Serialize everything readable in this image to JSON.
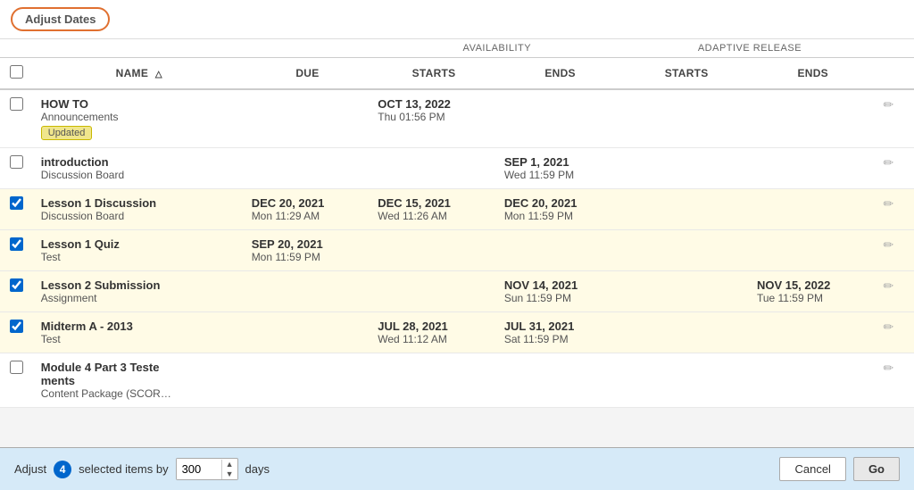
{
  "toolbar": {
    "adjust_dates_label": "Adjust Dates"
  },
  "table": {
    "section_headers": {
      "availability_label": "AVAILABILITY",
      "adaptive_release_label": "ADAPTIVE RELEASE"
    },
    "col_headers": {
      "name_label": "NAME",
      "due_label": "DUE",
      "avail_starts_label": "STARTS",
      "avail_ends_label": "ENDS",
      "ar_starts_label": "STARTS",
      "ar_ends_label": "ENDS"
    },
    "rows": [
      {
        "id": "row-how-to",
        "checked": false,
        "selected": false,
        "name": "HOW TO",
        "type": "Announcements",
        "badge": "Updated",
        "due": "",
        "due_sub": "",
        "avail_starts": "OCT 13, 2022",
        "avail_starts_sub": "Thu 01:56 PM",
        "avail_ends": "",
        "avail_ends_sub": "",
        "ar_starts": "",
        "ar_starts_sub": "",
        "ar_ends": "",
        "ar_ends_sub": ""
      },
      {
        "id": "row-introduction",
        "checked": false,
        "selected": false,
        "name": "introduction",
        "type": "Discussion Board",
        "badge": "",
        "due": "",
        "due_sub": "",
        "avail_starts": "",
        "avail_starts_sub": "",
        "avail_ends": "SEP 1, 2021",
        "avail_ends_sub": "Wed 11:59 PM",
        "ar_starts": "",
        "ar_starts_sub": "",
        "ar_ends": "",
        "ar_ends_sub": ""
      },
      {
        "id": "row-lesson1-discussion",
        "checked": true,
        "selected": true,
        "name": "Lesson 1 Discussion",
        "type": "Discussion Board",
        "badge": "",
        "due": "DEC 20, 2021",
        "due_sub": "Mon 11:29 AM",
        "avail_starts": "DEC 15, 2021",
        "avail_starts_sub": "Wed 11:26 AM",
        "avail_ends": "DEC 20, 2021",
        "avail_ends_sub": "Mon 11:59 PM",
        "ar_starts": "",
        "ar_starts_sub": "",
        "ar_ends": "",
        "ar_ends_sub": ""
      },
      {
        "id": "row-lesson1-quiz",
        "checked": true,
        "selected": true,
        "name": "Lesson 1 Quiz",
        "type": "Test",
        "badge": "",
        "due": "SEP 20, 2021",
        "due_sub": "Mon 11:59 PM",
        "avail_starts": "",
        "avail_starts_sub": "",
        "avail_ends": "",
        "avail_ends_sub": "",
        "ar_starts": "",
        "ar_starts_sub": "",
        "ar_ends": "",
        "ar_ends_sub": ""
      },
      {
        "id": "row-lesson2-submission",
        "checked": true,
        "selected": true,
        "name": "Lesson 2 Submission",
        "type": "Assignment",
        "badge": "",
        "due": "",
        "due_sub": "",
        "avail_starts": "",
        "avail_starts_sub": "",
        "avail_ends": "NOV 14, 2021",
        "avail_ends_sub": "Sun 11:59 PM",
        "ar_starts": "",
        "ar_starts_sub": "",
        "ar_ends": "NOV 15, 2022",
        "ar_ends_sub": "Tue 11:59 PM"
      },
      {
        "id": "row-midterm-a",
        "checked": true,
        "selected": true,
        "name": "Midterm A - 2013",
        "type": "Test",
        "badge": "",
        "due": "",
        "due_sub": "",
        "avail_starts": "JUL 28, 2021",
        "avail_starts_sub": "Wed 11:12 AM",
        "avail_ends": "JUL 31, 2021",
        "avail_ends_sub": "Sat 11:59 PM",
        "ar_starts": "",
        "ar_starts_sub": "",
        "ar_ends": "",
        "ar_ends_sub": ""
      },
      {
        "id": "row-module4",
        "checked": false,
        "selected": false,
        "name": "Module 4 Part 3 Test…\nments",
        "name_line1": "Module 4 Part 3 Teste",
        "name_line2": "ments",
        "type": "Content Package (SCOR…",
        "badge": "",
        "due": "",
        "due_sub": "",
        "avail_starts": "",
        "avail_starts_sub": "",
        "avail_ends": "",
        "avail_ends_sub": "",
        "ar_starts": "",
        "ar_starts_sub": "",
        "ar_ends": "",
        "ar_ends_sub": ""
      }
    ]
  },
  "bottom_bar": {
    "adjust_label": "Adjust",
    "selected_count": "4",
    "selected_items_label": "selected items by",
    "days_value": "300",
    "days_label": "days",
    "cancel_label": "Cancel",
    "go_label": "Go"
  }
}
